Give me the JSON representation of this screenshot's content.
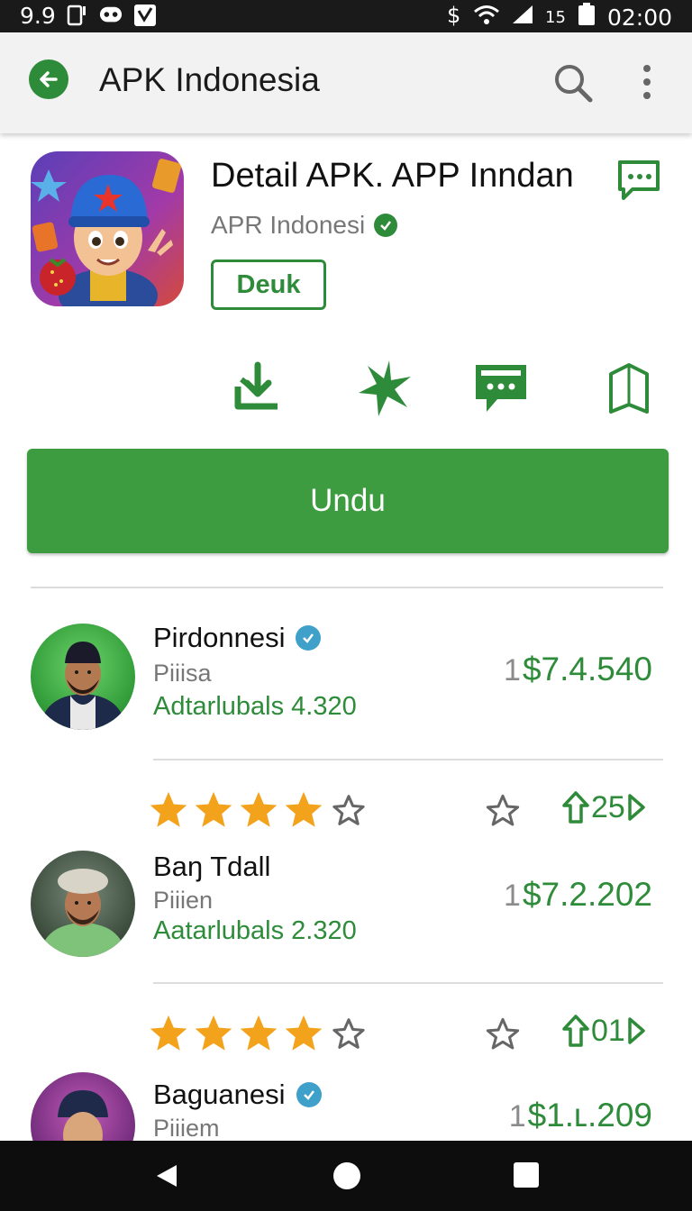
{
  "status_bar": {
    "left_time": "9.9",
    "battery_text": "15",
    "time": "02:00",
    "icons": [
      "sim-icon",
      "messenger-icon",
      "vpn-icon",
      "dollar-icon",
      "wifi-icon",
      "signal-icon",
      "battery-icon"
    ]
  },
  "app_bar": {
    "title": "APK Indonesia"
  },
  "app": {
    "name": "Detail APK. APP Inndan",
    "developer": "APR Indonesi",
    "tag_label": "Deuk",
    "download_label": "Undu"
  },
  "actions": [
    {
      "icon": "download-icon"
    },
    {
      "icon": "star-burst-icon"
    },
    {
      "icon": "comment-icon"
    },
    {
      "icon": "bookmark-icon"
    }
  ],
  "reviews": [
    {
      "name": "Pirdonnesi",
      "verified": true,
      "subtitle": "Piiisa",
      "stat": "Adtarlubals 4.320",
      "price_lead": "1",
      "price": "$7.4.540"
    },
    {
      "name": "Baŋ Tdall",
      "verified": false,
      "subtitle": "Piiien",
      "stat": "Aatarlubals 2.320",
      "price_lead": "1",
      "price": "$7.2.202"
    },
    {
      "name": "Baguanesi",
      "verified": true,
      "subtitle": "Piiiem",
      "stat": "",
      "price_lead": "1",
      "price": "$1.ʟ.209"
    }
  ],
  "rating_rows": [
    {
      "filled_stars": 4,
      "total_stars": 5,
      "share_count": "25"
    },
    {
      "filled_stars": 4,
      "total_stars": 5,
      "share_count": "01"
    }
  ],
  "colors": {
    "accent": "#2e8b3a",
    "button": "#3c9c3f",
    "star": "#f2a21b",
    "verified": "#3fa0c9"
  }
}
